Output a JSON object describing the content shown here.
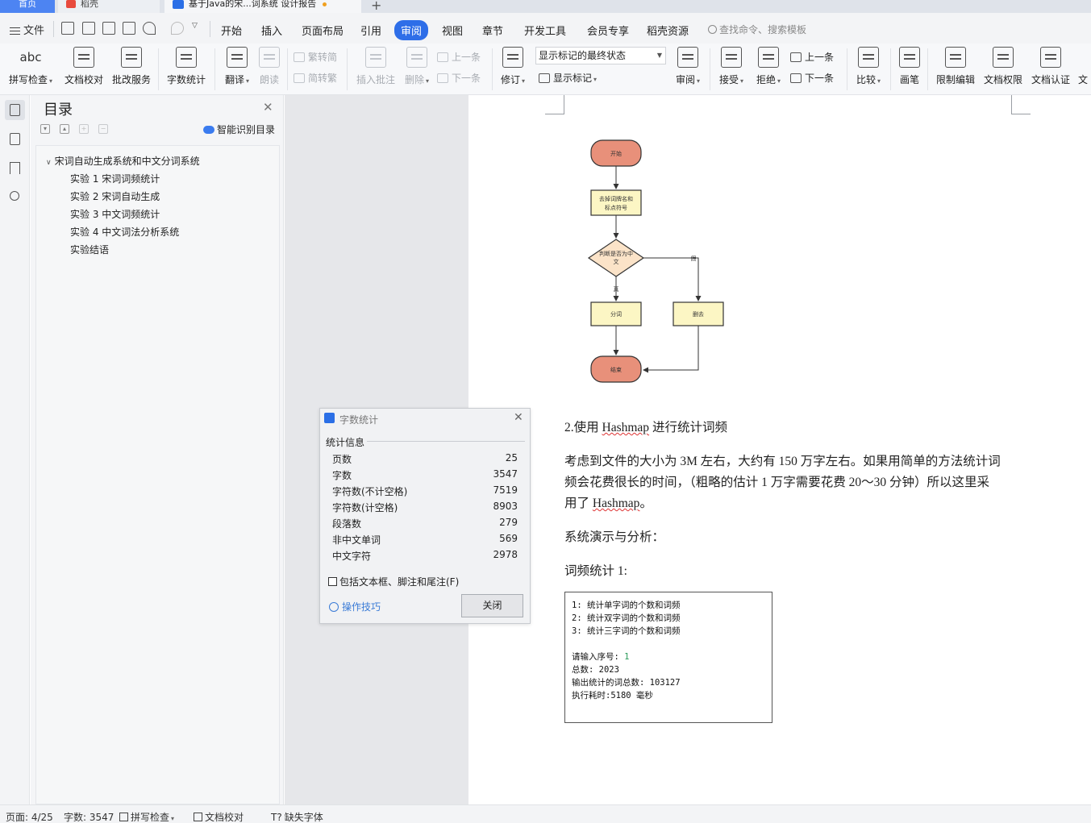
{
  "tabs": {
    "home": "首页",
    "daoke": "稻壳",
    "document": "基于Java的宋...词系统 设计报告",
    "new_tab": "+"
  },
  "menu": {
    "file": "文件",
    "items": [
      "开始",
      "插入",
      "页面布局",
      "引用",
      "审阅",
      "视图",
      "章节",
      "开发工具",
      "会员专享",
      "稻壳资源"
    ],
    "active": "审阅",
    "search_placeholder": "查找命令、搜索模板"
  },
  "ribbon": {
    "spell_icon_text": "abc",
    "spell_check": "拼写检查",
    "doc_proofread": "文档校对",
    "revision_service": "批改服务",
    "word_count": "字数统计",
    "translate": "翻译",
    "read_aloud": "朗读",
    "to_traditional": "繁转简",
    "to_simplified": "简转繁",
    "insert_comment": "插入批注",
    "delete": "删除",
    "prev_comment": "上一条",
    "next_comment": "下一条",
    "track_changes": "修订",
    "markup_view": "显示标记的最终状态",
    "show_markup": "显示标记",
    "review": "审阅",
    "accept": "接受",
    "reject": "拒绝",
    "prev_change": "上一条",
    "next_change": "下一条",
    "compare": "比较",
    "pen": "画笔",
    "restrict_editing": "限制编辑",
    "doc_permissions": "文档权限",
    "doc_certification": "文档认证",
    "overflow": "文"
  },
  "toc": {
    "title": "目录",
    "smart_toc": "智能识别目录",
    "items": [
      {
        "label": "宋词自动生成系统和中文分词系统",
        "level": 1
      },
      {
        "label": "实验 1  宋词词频统计",
        "level": 2
      },
      {
        "label": "实验 2  宋词自动生成",
        "level": 2
      },
      {
        "label": "实验 3  中文词频统计",
        "level": 2
      },
      {
        "label": "实验 4  中文词法分析系统",
        "level": 2
      },
      {
        "label": "实验结语",
        "level": 2
      }
    ]
  },
  "flowchart": {
    "start": "开始",
    "remove_line1": "去掉词牌名和",
    "remove_line2": "标点符号",
    "decision_line1": "判断是否为中",
    "decision_line2": "文",
    "true_label": "真",
    "false_label": "假",
    "segment": "分词",
    "delete": "删去",
    "end": "结束",
    "colors": {
      "terminal": "#e8907a",
      "process": "#fcf6c4",
      "decision": "#fbe3c8"
    }
  },
  "document": {
    "heading": "2.使用 Hashmap 进行统计词频",
    "para_line1": "考虑到文件的大小为 3M 左右，大约有 150 万字左右。如果用简单的方法统计词",
    "para_line2": "频会花费很长的时间，（粗略的估计 1 万字需要花费 20～30 分钟）所以这里采",
    "para_line3": "用了 Hashmap。",
    "demo_heading": "系统演示与分析：",
    "caption": "词频统计 1:"
  },
  "console": {
    "lines": [
      "1: 统计单字词的个数和词频",
      "2: 统计双字词的个数和词频",
      "3: 统计三字词的个数和词频",
      "",
      "请输入序号: ",
      "总数: 2023",
      "输出统计的词总数: 103127",
      "执行耗时:5180 毫秒"
    ],
    "input_value": "1"
  },
  "dialog": {
    "title": "字数统计",
    "section": "统计信息",
    "stats": [
      {
        "label": "页数",
        "value": "25"
      },
      {
        "label": "字数",
        "value": "3547"
      },
      {
        "label": "字符数(不计空格)",
        "value": "7519"
      },
      {
        "label": "字符数(计空格)",
        "value": "8903"
      },
      {
        "label": "段落数",
        "value": "279"
      },
      {
        "label": "非中文单词",
        "value": "569"
      },
      {
        "label": "中文字符",
        "value": "2978"
      }
    ],
    "include_checkbox": "包括文本框、脚注和尾注(F)",
    "include_checked": false,
    "tips": "操作技巧",
    "close": "关闭"
  },
  "status": {
    "page": "页面: 4/25",
    "words": "字数: 3547",
    "spell": "拼写检查",
    "proof": "文档校对",
    "missing_fonts": "缺失字体"
  },
  "colors": {
    "accent": "#2e6ee8",
    "home_tab": "#4d84f2",
    "link": "#3a7bd6"
  }
}
